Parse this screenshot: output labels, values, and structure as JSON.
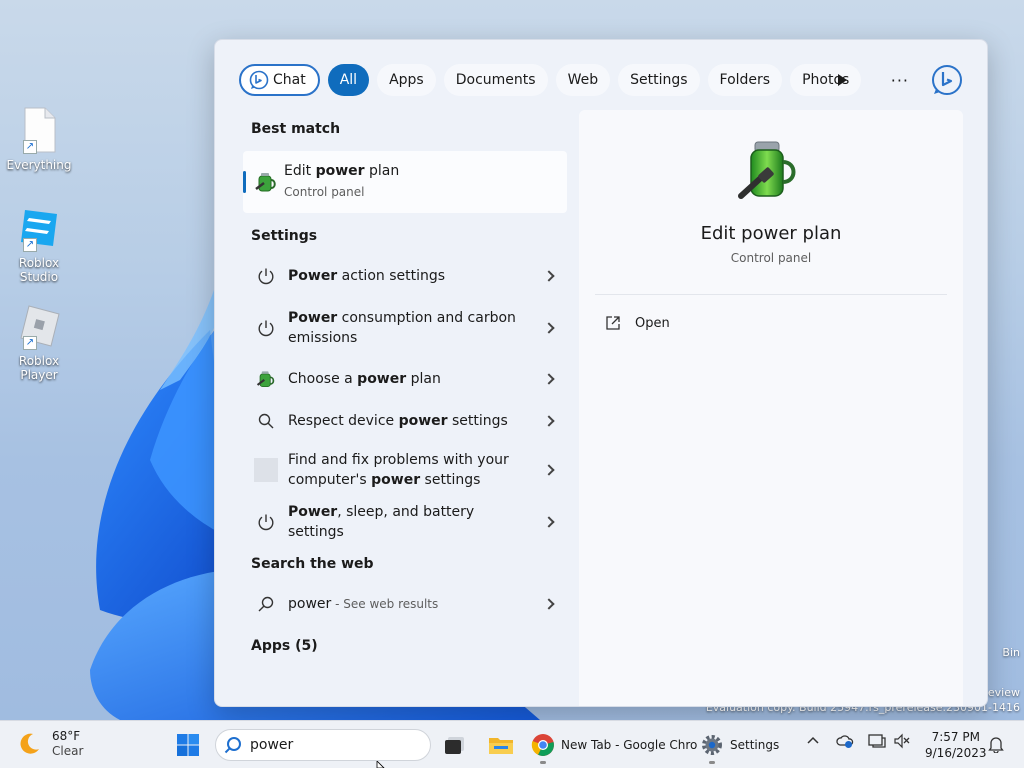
{
  "desktop": {
    "icons": [
      {
        "label": "Everything"
      },
      {
        "label": "Roblox Studio"
      },
      {
        "label": "Roblox Player"
      }
    ],
    "watermark_bin": "Bin",
    "watermark_review": "eview",
    "watermark_eval": "Evaluation copy. Build 25947.rs_prerelease.230901-1416"
  },
  "search": {
    "filters": {
      "chat": "Chat",
      "all": "All",
      "apps": "Apps",
      "documents": "Documents",
      "web": "Web",
      "settings": "Settings",
      "folders": "Folders",
      "photos": "Photos"
    },
    "best_match_heading": "Best match",
    "best_match": {
      "title_pre": "Edit ",
      "title_bold": "power",
      "title_post": " plan",
      "subtitle": "Control panel"
    },
    "settings_heading": "Settings",
    "settings_items": [
      {
        "pre": "",
        "bold": "Power",
        "post": " action settings"
      },
      {
        "pre": "",
        "bold": "Power",
        "post": " consumption and carbon emissions"
      },
      {
        "pre": "Choose a ",
        "bold": "power",
        "post": " plan"
      },
      {
        "pre": "Respect device ",
        "bold": "power",
        "post": " settings"
      },
      {
        "pre": "Find and fix problems with your computer's ",
        "bold": "power",
        "post": " settings"
      },
      {
        "pre": "",
        "bold": "Power",
        "post": ", sleep, and battery settings"
      }
    ],
    "web_heading": "Search the web",
    "web_query": "power",
    "web_suffix": " - See web results",
    "apps_heading": "Apps (5)",
    "detail": {
      "title": "Edit power plan",
      "subtitle": "Control panel",
      "open_label": "Open"
    }
  },
  "taskbar": {
    "weather_temp": "68°F",
    "weather_cond": "Clear",
    "search_value": "power",
    "chrome_label": "New Tab - Google Chro",
    "settings_label": "Settings",
    "time": "7:57 PM",
    "date": "9/16/2023"
  },
  "colors": {
    "accent": "#0f6cbd",
    "panel_bg": "#eef2f9",
    "taskbar_bg": "#eef1f6"
  }
}
